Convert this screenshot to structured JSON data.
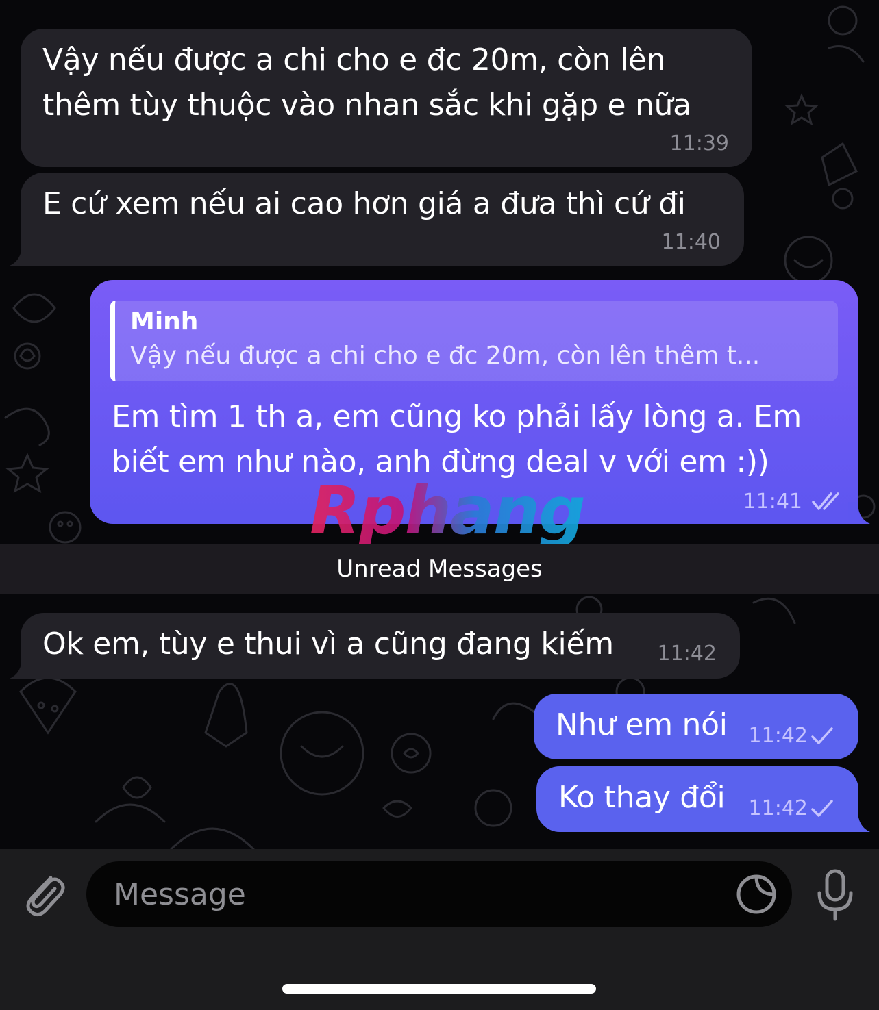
{
  "colors": {
    "background": "#07070a",
    "incoming_bubble": "#232228",
    "outgoing_bubble": "#6c5cf3",
    "unread_bar": "#1d1b20",
    "composer": "#1c1c1e"
  },
  "messages": [
    {
      "direction": "incoming",
      "lines": [
        "Vậy nếu được a chi cho e đc 20m, còn lên",
        "thêm tùy thuộc vào nhan sắc khi gặp e nữa"
      ],
      "time": "11:39"
    },
    {
      "direction": "incoming",
      "lines": [
        "E cứ xem nếu ai cao hơn giá a đưa thì cứ đi"
      ],
      "time": "11:40"
    },
    {
      "direction": "outgoing",
      "reply": {
        "name": "Minh",
        "text": "Vậy nếu được a chi cho e đc 20m, còn lên thêm t..."
      },
      "lines": [
        "Em tìm 1 th a, em cũng ko phải lấy lòng a. Em",
        "biết em như nào, anh đừng deal v với em :))"
      ],
      "time": "11:41",
      "status_icon": "double-check-icon"
    },
    {
      "direction": "incoming",
      "lines": [
        "Ok em, tùy e thui vì a cũng đang kiếm"
      ],
      "time": "11:42"
    },
    {
      "direction": "outgoing",
      "lines": [
        "Như em nói"
      ],
      "time": "11:42",
      "status_icon": "check-icon"
    },
    {
      "direction": "outgoing",
      "lines": [
        "Ko thay đổi"
      ],
      "time": "11:42",
      "status_icon": "check-icon"
    }
  ],
  "unread_divider": "Unread Messages",
  "watermark": "Rphang",
  "composer": {
    "placeholder": "Message",
    "attach_icon": "paperclip-icon",
    "sticker_icon": "sticker-icon",
    "mic_icon": "microphone-icon"
  }
}
